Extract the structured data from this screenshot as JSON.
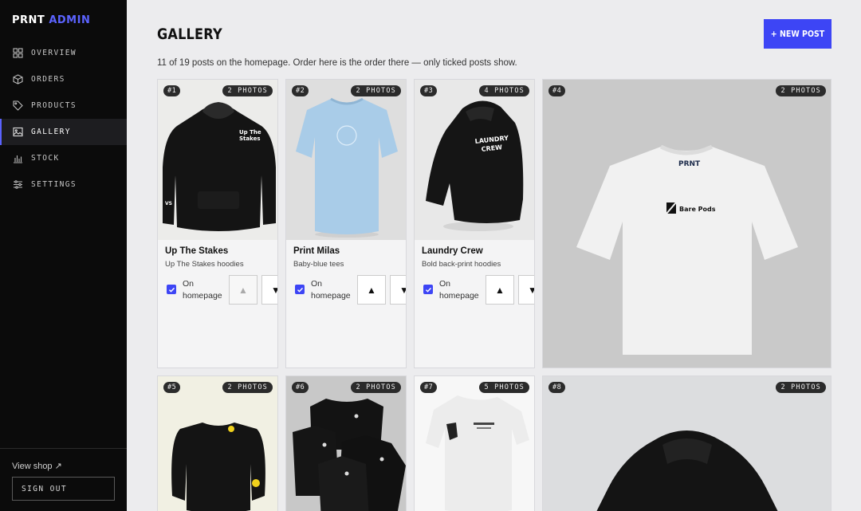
{
  "brand": {
    "prefix": "PRNT",
    "accent": "ADMIN"
  },
  "nav": [
    {
      "label": "OVERVIEW",
      "icon": "grid-icon"
    },
    {
      "label": "ORDERS",
      "icon": "box-icon"
    },
    {
      "label": "PRODUCTS",
      "icon": "tag-icon"
    },
    {
      "label": "GALLERY",
      "icon": "image-icon",
      "active": true
    },
    {
      "label": "STOCK",
      "icon": "bar-chart-icon"
    },
    {
      "label": "SETTINGS",
      "icon": "sliders-icon"
    }
  ],
  "sidebar_footer": {
    "view_shop": "View shop ↗",
    "sign_out": "SIGN OUT"
  },
  "page": {
    "title": "GALLERY",
    "new_post": "+ NEW POST",
    "subtitle": "11 of 19 posts on the homepage. Order here is the order there — only ticked posts show."
  },
  "posts": [
    {
      "num": "#1",
      "photos": "2 PHOTOS",
      "name": "Up The Stakes",
      "desc": "Up The Stakes hoodies",
      "homepage_label": "On homepage",
      "on_homepage": true,
      "garment_text": "Up The Stakes"
    },
    {
      "num": "#2",
      "photos": "2 PHOTOS",
      "name": "Print Milas",
      "desc": "Baby-blue tees",
      "homepage_label": "On homepage",
      "on_homepage": true
    },
    {
      "num": "#3",
      "photos": "4 PHOTOS",
      "name": "Laundry Crew",
      "desc": "Bold back-print hoodies",
      "homepage_label": "On homepage",
      "on_homepage": true,
      "garment_text": "LAUNDRY CREW"
    },
    {
      "num": "#4",
      "photos": "2 PHOTOS",
      "garment_text": "PRNT",
      "logo_text": "Bare Pods"
    },
    {
      "num": "#5",
      "photos": "2 PHOTOS"
    },
    {
      "num": "#6",
      "photos": "2 PHOTOS"
    },
    {
      "num": "#7",
      "photos": "5 PHOTOS"
    },
    {
      "num": "#8",
      "photos": "2 PHOTOS"
    }
  ],
  "colors": {
    "accent": "#3d45f5",
    "sidebar": "#0b0b0b"
  }
}
